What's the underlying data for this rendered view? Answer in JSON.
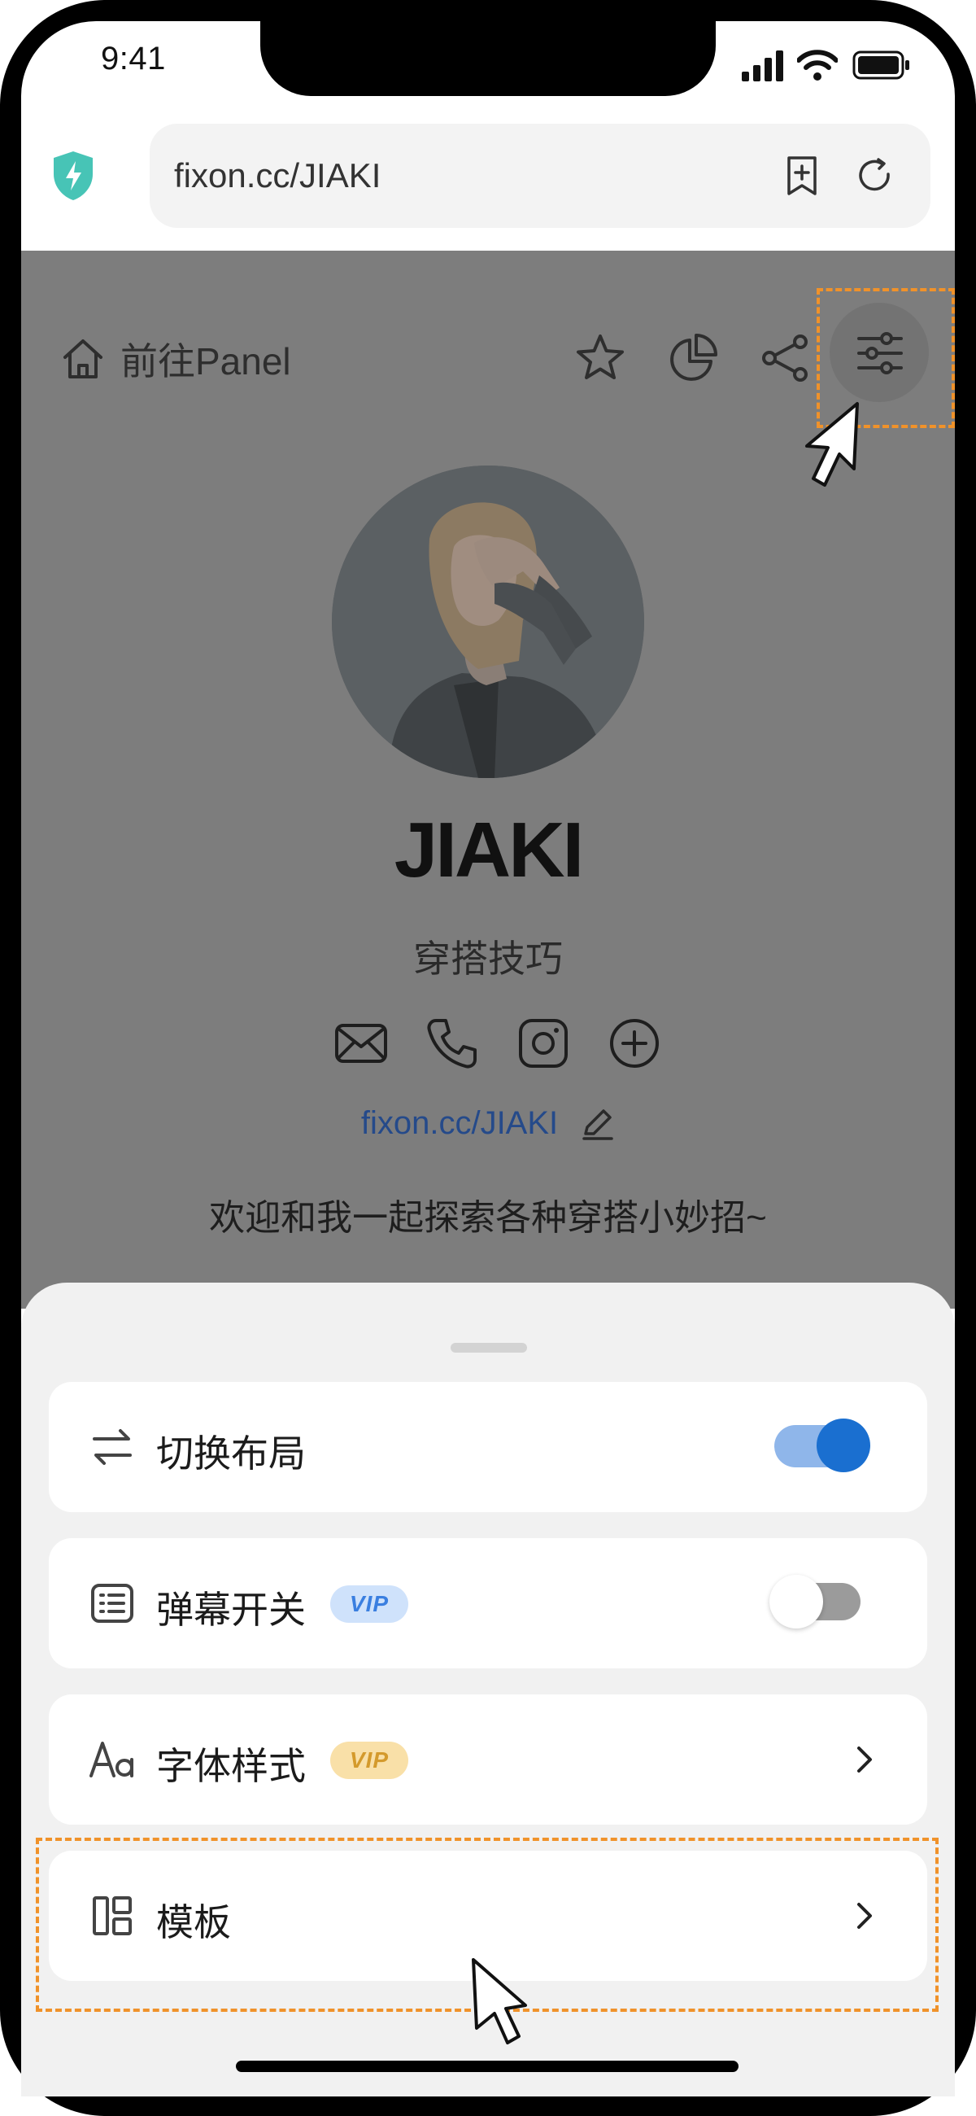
{
  "status_bar": {
    "time": "9:41"
  },
  "browser": {
    "url": "fixon.cc/JIAKI"
  },
  "page": {
    "go_panel_label": "前往Panel",
    "profile": {
      "name": "JIAKI",
      "tagline": "穿搭技巧",
      "link": "fixon.cc/JIAKI",
      "bio": "欢迎和我一起探索各种穿搭小妙招~"
    },
    "social_icons": [
      "mail-icon",
      "phone-icon",
      "instagram-icon",
      "add-circle-icon"
    ]
  },
  "sheet": {
    "items": [
      {
        "label": "切换布局",
        "icon": "swap-icon",
        "control": "toggle",
        "enabled": true
      },
      {
        "label": "弹幕开关",
        "icon": "danmaku-icon",
        "badge": "VIP",
        "control": "toggle",
        "enabled": false
      },
      {
        "label": "字体样式",
        "icon": "font-icon",
        "badge": "VIP",
        "control": "chevron"
      },
      {
        "label": "模板",
        "icon": "template-icon",
        "control": "chevron"
      }
    ]
  },
  "colors": {
    "highlight": "#f0922a",
    "toggle_on": "#1a6fd0",
    "vip_blue": "#cfe2fb",
    "vip_gold": "#f9e0a8",
    "link": "#254a8a"
  }
}
